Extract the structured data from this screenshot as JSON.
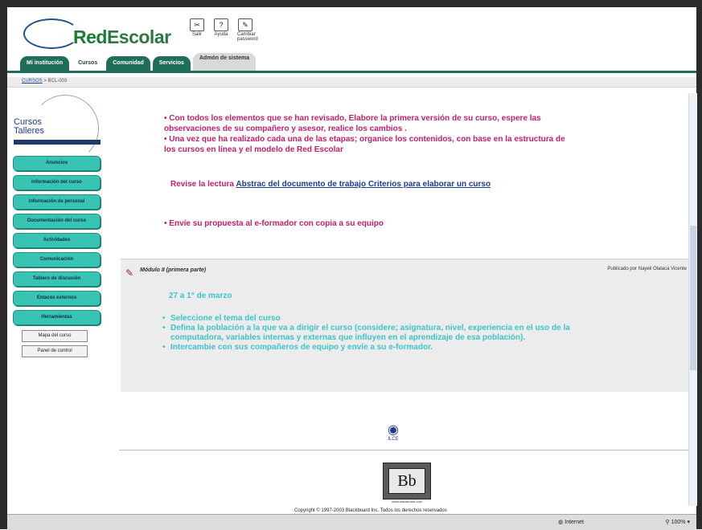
{
  "header": {
    "logo_red": "Red",
    "logo_escolar": "Escolar",
    "icons": [
      {
        "glyph": "✂",
        "label": "Salir"
      },
      {
        "glyph": "?",
        "label": "Ayuda"
      },
      {
        "glyph": "✎",
        "label": "Cambiar password"
      }
    ],
    "tabs": [
      "Mi institución",
      "Cursos",
      "Comunidad",
      "Servicios",
      "Admón de sistema"
    ]
  },
  "breadcrumb": {
    "link": "CURSOS",
    "sep": ">",
    "current": "BCL-003"
  },
  "sidebar": {
    "logo_line1": "Cursos",
    "logo_line2": "Talleres",
    "buttons": [
      "Anuncios",
      "Información del curso",
      "Información de personal",
      "Documentación del curso",
      "Actividades",
      "Comunicación",
      "Tablero de discusión",
      "Enlaces externos",
      "Herramientas"
    ],
    "small_buttons": [
      "Mapa del curso",
      "Panel de control"
    ]
  },
  "content": {
    "bullets": [
      "Con todos los elementos que se han revisado, Elabore la primera versión de su curso, espere las observaciones de su compañero y asesor, realice los cambios .",
      "Una vez que ha realizado cada una de las etapas; organice los contenidos, con base en la estructura de los cursos en línea y el modelo de Red Escolar"
    ],
    "revise_prefix": "Revise la lectura",
    "revise_link": "Abstrac del documento de trabajo Criterios para elaborar un curso",
    "bullet3": "Envíe su propuesta al e-formador con copia a su equipo"
  },
  "module": {
    "title": "Módulo II (primera parte)",
    "posted_by": "Publicado por Nayeli Olalaca Vicente",
    "date": "27 a 1° de marzo",
    "items": [
      "Seleccione el tema del curso",
      "Defina la población a la que va a dirigir el curso (considere; asignatura, nivel, experiencia en el uso de la computadora, variables internas y externas que influyen en el aprendizaje de esa población).",
      "Intercambie con sus compañeros de equipo y envíe a su e-formador."
    ]
  },
  "footer": {
    "ilce": "ILCE",
    "bb_text": "Bb",
    "bb_url": "www.blackboard.com",
    "copyright": "Copyright © 1997-2003 Blackboard Inc. Todos los derechos reservados"
  },
  "status": {
    "zone": "Internet",
    "zoom": "100%"
  },
  "colors": {
    "accent": "#39c3b3",
    "pink": "#c0206b",
    "cyan": "#3cc4c9",
    "tab": "#1e6e5a"
  }
}
